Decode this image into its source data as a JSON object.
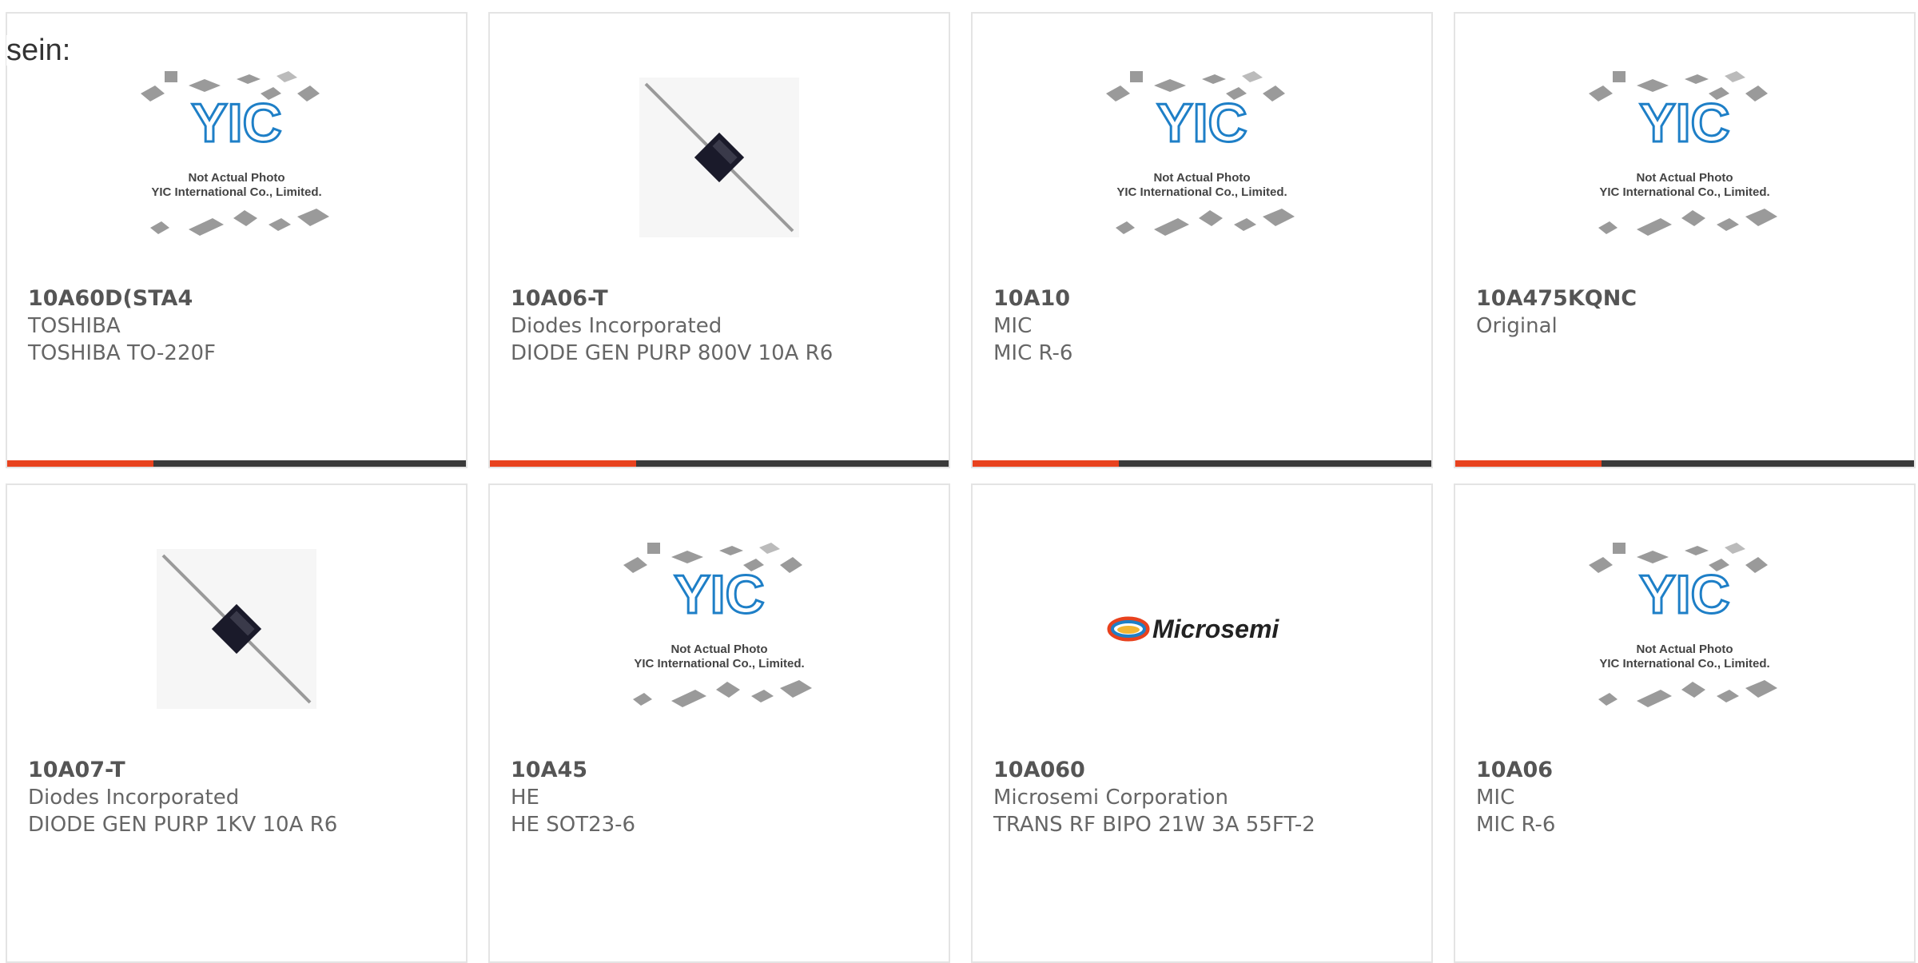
{
  "page_label": "sein:",
  "placeholder": {
    "line1": "Not Actual Photo",
    "line2": "YIC International Co., Limited."
  },
  "colors": {
    "accent": "#e8421e",
    "bar": "#3a3a3a",
    "yic_blue": "#1e7fc7"
  },
  "products": [
    {
      "pn": "10A60D(STA4",
      "mfr": "TOSHIBA",
      "desc": "TOSHIBA TO-220F",
      "image": "yic-placeholder"
    },
    {
      "pn": "10A06-T",
      "mfr": "Diodes Incorporated",
      "desc": "DIODE GEN PURP 800V 10A R6",
      "image": "axial-diode"
    },
    {
      "pn": "10A10",
      "mfr": "MIC",
      "desc": "MIC R-6",
      "image": "yic-placeholder"
    },
    {
      "pn": "10A475KQNC",
      "mfr": "Original",
      "desc": "",
      "image": "yic-placeholder"
    },
    {
      "pn": "10A07-T",
      "mfr": "Diodes Incorporated",
      "desc": "DIODE GEN PURP 1KV 10A R6",
      "image": "axial-diode"
    },
    {
      "pn": "10A45",
      "mfr": "HE",
      "desc": "HE SOT23-6",
      "image": "yic-placeholder"
    },
    {
      "pn": "10A060",
      "mfr": "Microsemi Corporation",
      "desc": "TRANS RF BIPO 21W 3A 55FT-2",
      "image": "microsemi-logo",
      "logo_text": "Microsemi"
    },
    {
      "pn": "10A06",
      "mfr": "MIC",
      "desc": "MIC R-6",
      "image": "yic-placeholder"
    }
  ]
}
